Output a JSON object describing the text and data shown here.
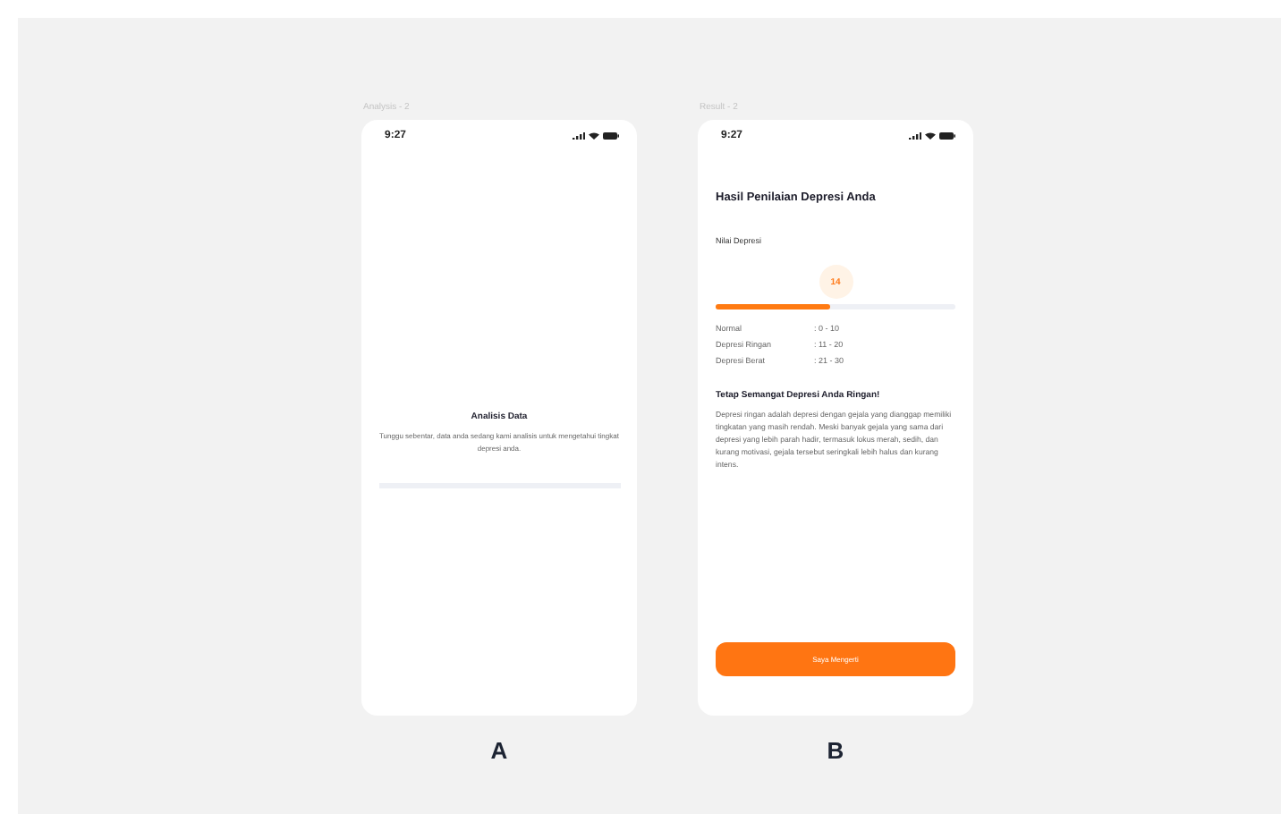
{
  "screens": [
    {
      "frame_label": "Analysis - 2",
      "time": "9:27",
      "kind": "loading",
      "heading": "Analisis Data",
      "message": "Tunggu sebentar, data anda sedang kami analisis untuk mengetahui tingkat depresi anda.",
      "caption": "A"
    },
    {
      "frame_label": "Result - 2",
      "time": "9:27",
      "kind": "result",
      "heading": "Hasil Penilaian Depresi Anda",
      "score_label": "Nilai Depresi",
      "score": "14",
      "level": 0.48,
      "ranges": [
        {
          "name": "Normal",
          "value": ": 0 - 10"
        },
        {
          "name": "Depresi Ringan",
          "value": ": 11 - 20"
        },
        {
          "name": "Depresi Berat",
          "value": ": 21 - 30"
        }
      ],
      "subheading": "Tetap Semangat Depresi Anda Ringan!",
      "description": "Depresi ringan adalah depresi dengan gejala yang dianggap memiliki tingkatan yang masih rendah. Meski banyak gejala yang sama dari depresi yang lebih parah hadir, termasuk lokus merah, sedih, dan kurang motivasi, gejala tersebut seringkali lebih halus dan kurang intens.",
      "button": "Saya Mengerti",
      "caption": "B"
    }
  ]
}
